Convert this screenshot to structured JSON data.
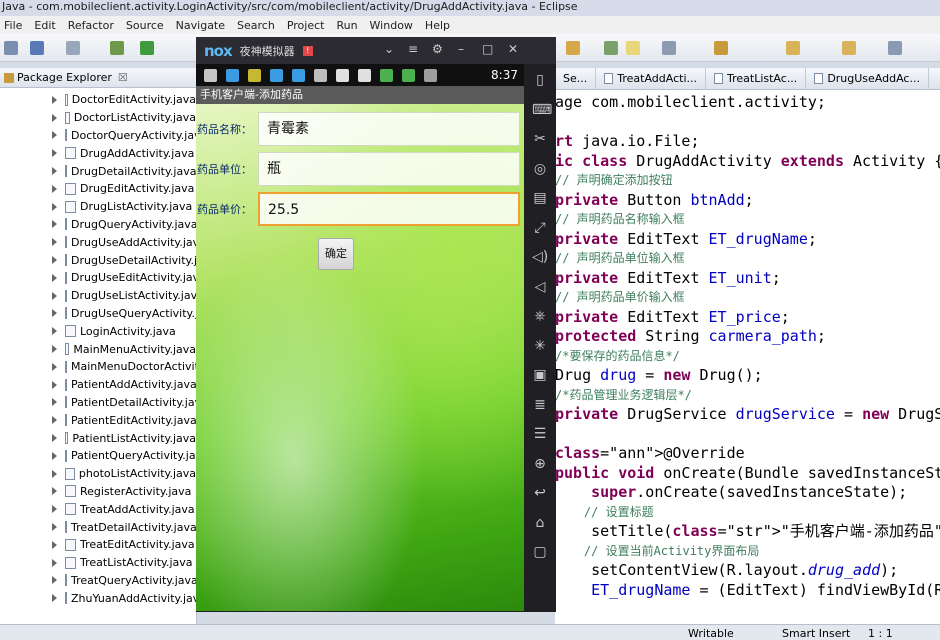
{
  "window": {
    "title": "Java - com.mobileclient.activity.LoginActivity/src/com/mobileclient/activity/DrugAddActivity.java - Eclipse"
  },
  "menu": [
    "File",
    "Edit",
    "Refactor",
    "Source",
    "Navigate",
    "Search",
    "Project",
    "Run",
    "Window",
    "Help"
  ],
  "package_explorer": {
    "tab_label": "Package Explorer",
    "close_glyph": "☒",
    "files": [
      "DoctorEditActivity.java",
      "DoctorListActivity.java",
      "DoctorQueryActivity.java",
      "DrugAddActivity.java",
      "DrugDetailActivity.java",
      "DrugEditActivity.java",
      "DrugListActivity.java",
      "DrugQueryActivity.java",
      "DrugUseAddActivity.java",
      "DrugUseDetailActivity.java",
      "DrugUseEditActivity.java",
      "DrugUseListActivity.java",
      "DrugUseQueryActivity.java",
      "LoginActivity.java",
      "MainMenuActivity.java",
      "MainMenuDoctorActivity.java",
      "PatientAddActivity.java",
      "PatientDetailActivity.java",
      "PatientEditActivity.java",
      "PatientListActivity.java",
      "PatientQueryActivity.java",
      "photoListActivity.java",
      "RegisterActivity.java",
      "TreatAddActivity.java",
      "TreatDetailActivity.java",
      "TreatEditActivity.java",
      "TreatListActivity.java",
      "TreatQueryActivity.java",
      "ZhuYuanAddActivity.java"
    ]
  },
  "editor": {
    "tabs": [
      "Se...",
      "TreatAddActi...",
      "TreatListAc...",
      "DrugUseAddAc..."
    ],
    "code_lines": [
      "age com.mobileclient.activity;",
      "",
      "rt java.io.File;",
      "ic class DrugAddActivity extends Activity {",
      "// 声明确定添加按钮",
      "private Button btnAdd;",
      "// 声明药品名称输入框",
      "private EditText ET_drugName;",
      "// 声明药品单位输入框",
      "private EditText ET_unit;",
      "// 声明药品单价输入框",
      "private EditText ET_price;",
      "protected String carmera_path;",
      "/*要保存的药品信息*/",
      "Drug drug = new Drug();",
      "/*药品管理业务逻辑层*/",
      "private DrugService drugService = new DrugS",
      "",
      "@Override",
      "public void onCreate(Bundle savedInstanceSt",
      "    super.onCreate(savedInstanceState);",
      "    // 设置标题",
      "    setTitle(\"手机客户端-添加药品\");",
      "    // 设置当前Activity界面布局",
      "    setContentView(R.layout.drug_add);",
      "    ET_drugName = (EditText) findViewById(R"
    ]
  },
  "status_bar": {
    "mode": "Writable",
    "insert": "Smart Insert",
    "position": "1 : 1"
  },
  "emulator": {
    "logo": "nox",
    "name": "夜神模拟器",
    "badge": "!",
    "controls": [
      "⌄",
      "≡",
      "⚙",
      "–",
      "□",
      "✕"
    ],
    "android_time": "8:37",
    "app_title": "手机客户端-添加药品",
    "fields": [
      {
        "label": "药品名称：",
        "value": "青霉素"
      },
      {
        "label": "药品单位：",
        "value": "瓶"
      },
      {
        "label": "药品单价：",
        "value": "25.5"
      }
    ],
    "confirm_label": "确定",
    "side_icons": [
      "▯",
      "⌨",
      "✂",
      "◎",
      "▤",
      "⤢",
      "◁)",
      "◁",
      "⎈",
      "✳",
      "▣",
      "≣",
      "☰",
      "⊕",
      "↩",
      "⌂",
      "▢"
    ]
  }
}
